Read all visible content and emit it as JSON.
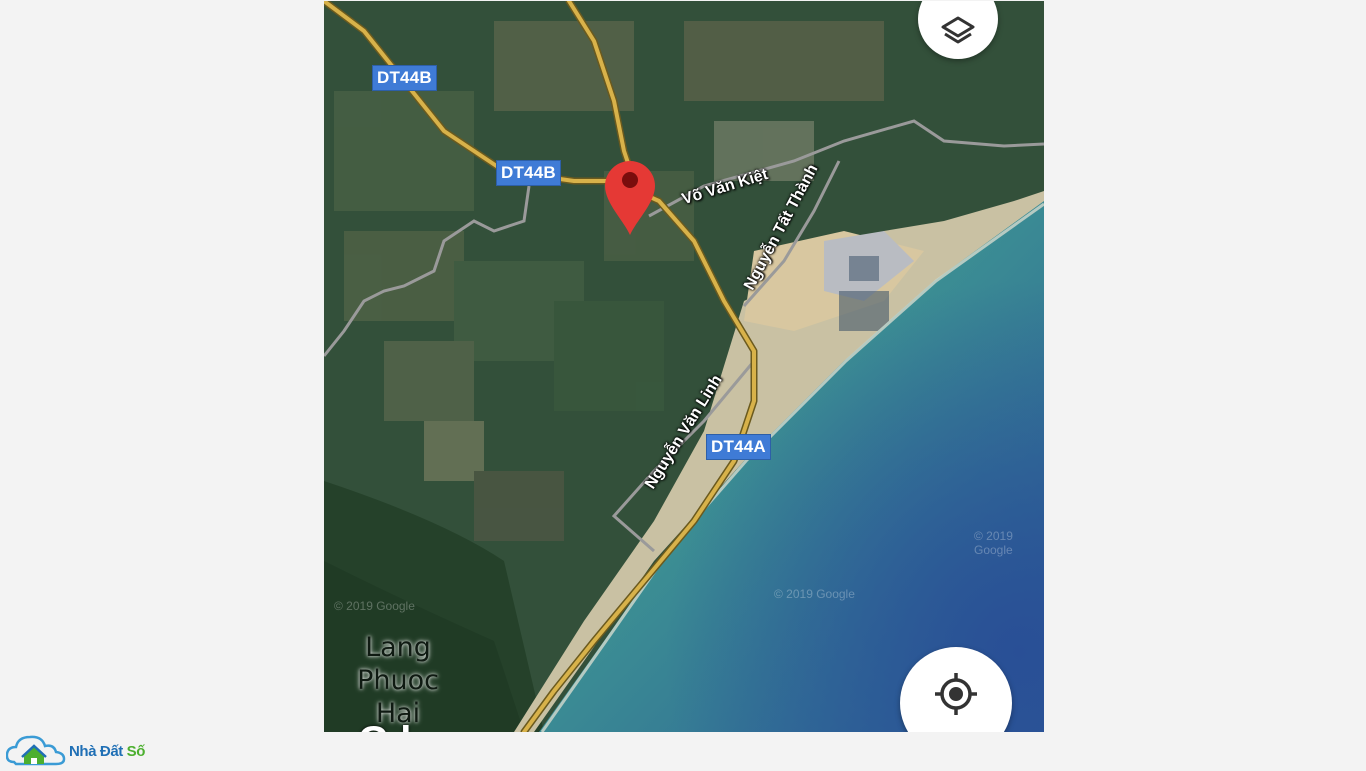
{
  "map": {
    "shields": {
      "dt44b_top": "DT44B",
      "dt44b_mid": "DT44B",
      "dt44a": "DT44A"
    },
    "road_labels": {
      "vo_van_kiet": "Võ Văn Kiệt",
      "nguyen_tat_thanh": "Nguyễn Tất Thành",
      "nguyen_van_linh": "Nguyễn Văn Linh"
    },
    "place_label": {
      "line1": "Lang",
      "line2": "Phuoc Hai"
    },
    "watermarks": [
      "© 2019 Google",
      "© 2019 Google",
      "© 2019 Google"
    ],
    "google_logo_fragment": "G    l",
    "colors": {
      "pin": "#e53935",
      "shield": "#3f7bd6",
      "highway": "#d8b24a",
      "sea_light": "#3f9a8c",
      "sea_deep": "#2f5f96"
    },
    "controls": {
      "layers_icon": "layers-icon",
      "location_icon": "my-location-icon"
    }
  },
  "brand": {
    "name_part1": "Nhà Đất ",
    "name_part2": "Số",
    "logo_icon": "house-cloud-icon"
  }
}
